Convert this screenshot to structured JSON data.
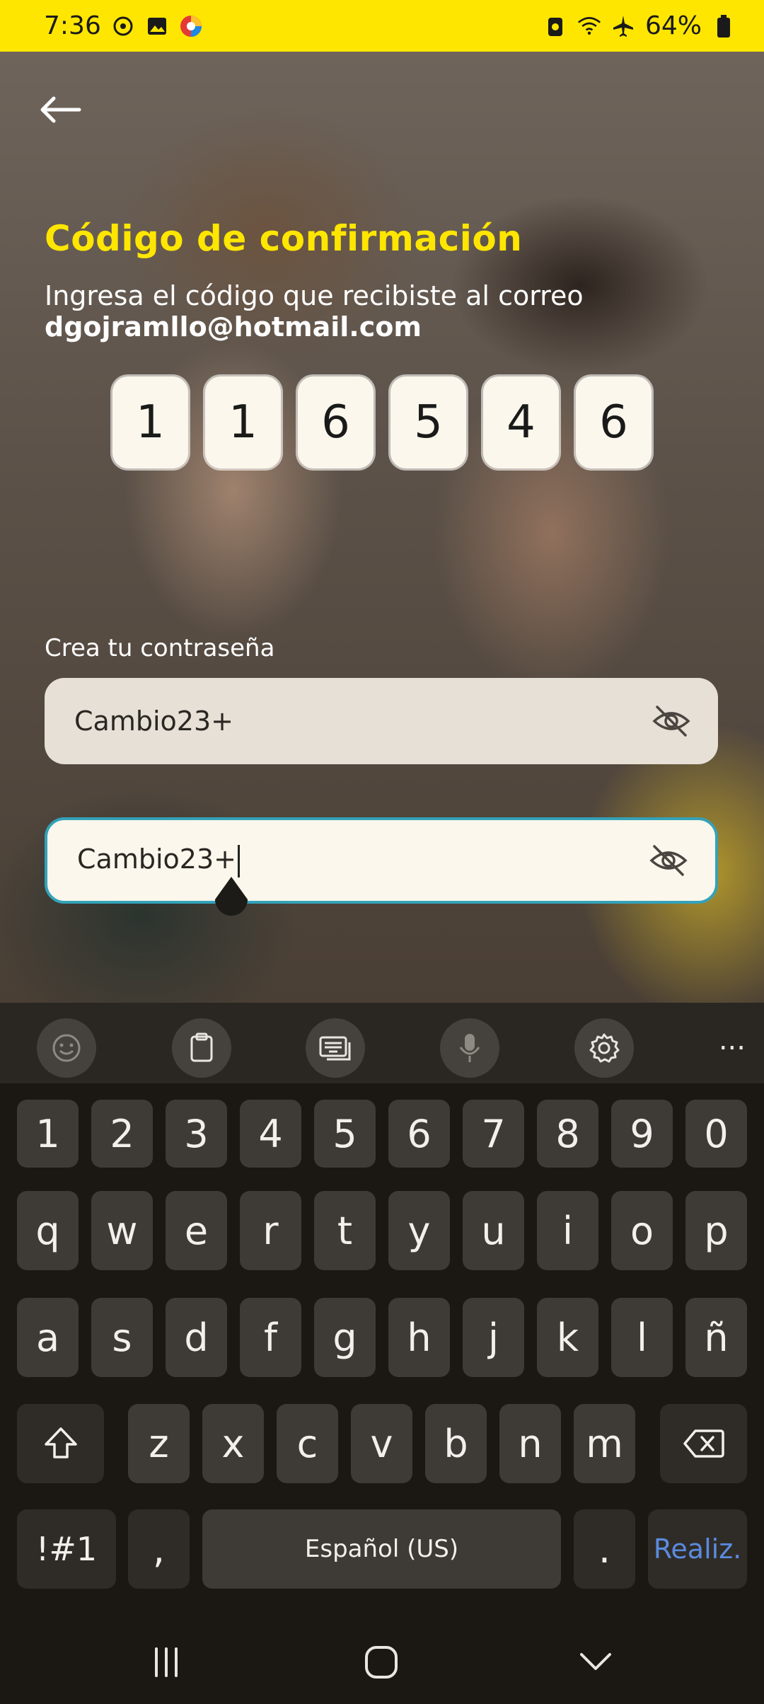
{
  "status_bar": {
    "time": "7:36",
    "battery": "64%"
  },
  "screen": {
    "title": "Código de confirmación",
    "subtitle": "Ingresa el código que recibiste al correo",
    "email": "dgojramllo@hotmail.com",
    "code_digits": [
      "1",
      "1",
      "6",
      "5",
      "4",
      "6"
    ],
    "password_label": "Crea tu contraseña",
    "password_value": "Cambio23+",
    "confirm_value": "Cambio23+"
  },
  "keyboard": {
    "row_numbers": [
      "1",
      "2",
      "3",
      "4",
      "5",
      "6",
      "7",
      "8",
      "9",
      "0"
    ],
    "row_1": [
      "q",
      "w",
      "e",
      "r",
      "t",
      "y",
      "u",
      "i",
      "o",
      "p"
    ],
    "row_2": [
      "a",
      "s",
      "d",
      "f",
      "g",
      "h",
      "j",
      "k",
      "l",
      "ñ"
    ],
    "row_3": [
      "z",
      "x",
      "c",
      "v",
      "b",
      "n",
      "m"
    ],
    "symbols_label": "!#1",
    "comma_label": ",",
    "space_label": "Español (US)",
    "period_label": ".",
    "done_label": "Realiz.",
    "more_label": "..."
  },
  "colors": {
    "accent_yellow": "#ffe600",
    "focus_border": "#34a2b8",
    "done_blue": "#5b8bdf"
  },
  "icons": [
    "back-arrow-icon",
    "eye-off-icon",
    "emoji-icon",
    "clipboard-icon",
    "keyboard-icon",
    "mic-icon",
    "gear-icon",
    "shift-icon",
    "backspace-icon"
  ]
}
